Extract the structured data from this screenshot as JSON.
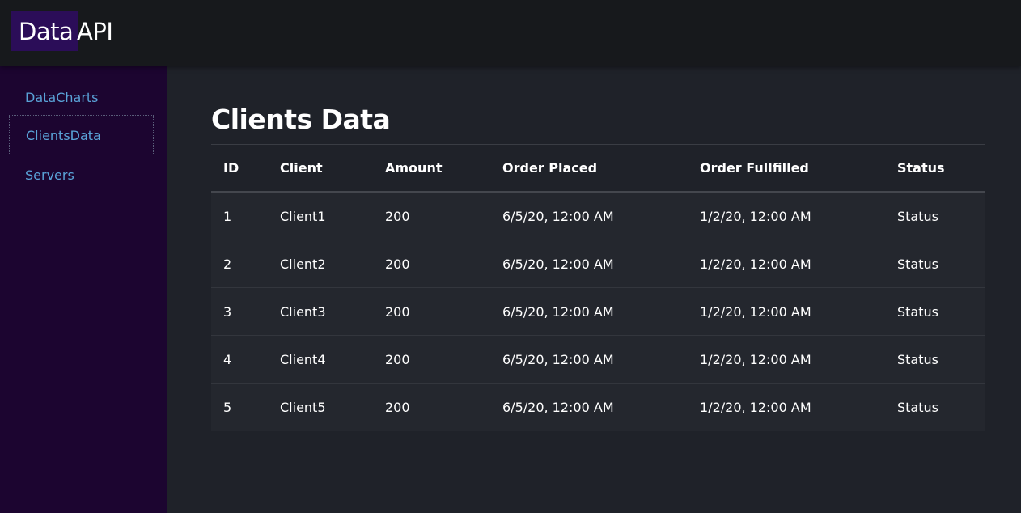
{
  "header": {
    "logo_part1": "Data",
    "logo_part2": "API"
  },
  "sidebar": {
    "items": [
      {
        "label": "DataCharts"
      },
      {
        "label": "ClientsData"
      },
      {
        "label": "Servers"
      }
    ]
  },
  "main": {
    "title": "Clients Data",
    "table": {
      "columns": [
        "ID",
        "Client",
        "Amount",
        "Order Placed",
        "Order Fullfilled",
        "Status"
      ],
      "rows": [
        [
          "1",
          "Client1",
          "200",
          "6/5/20, 12:00 AM",
          "1/2/20, 12:00 AM",
          "Status"
        ],
        [
          "2",
          "Client2",
          "200",
          "6/5/20, 12:00 AM",
          "1/2/20, 12:00 AM",
          "Status"
        ],
        [
          "3",
          "Client3",
          "200",
          "6/5/20, 12:00 AM",
          "1/2/20, 12:00 AM",
          "Status"
        ],
        [
          "4",
          "Client4",
          "200",
          "6/5/20, 12:00 AM",
          "1/2/20, 12:00 AM",
          "Status"
        ],
        [
          "5",
          "Client5",
          "200",
          "6/5/20, 12:00 AM",
          "1/2/20, 12:00 AM",
          "Status"
        ]
      ]
    }
  },
  "colors": {
    "sidebar_bg": "#1c0530",
    "logo_accent": "#2b0d58",
    "link": "#5aa3d8"
  }
}
